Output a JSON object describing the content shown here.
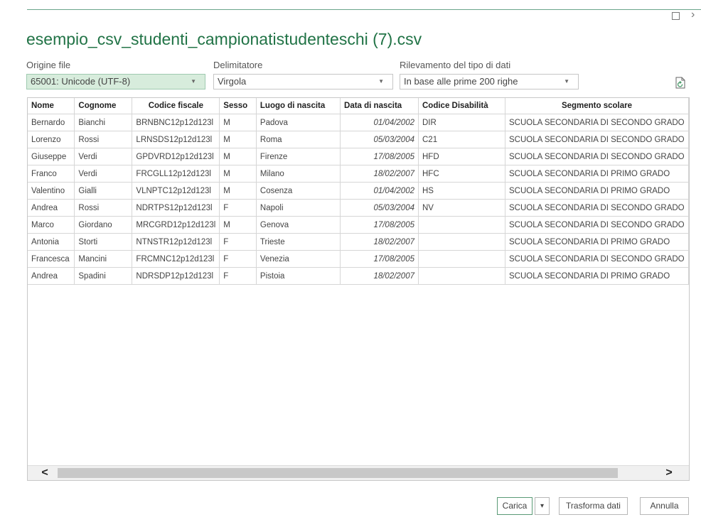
{
  "window": {
    "title": "esempio_csv_studenti_campionatistudenteschi (7).csv",
    "maximize_glyph": "☐",
    "close_glyph": "›"
  },
  "settings": {
    "origin": {
      "label": "Origine file",
      "value": "65001: Unicode (UTF-8)"
    },
    "delimiter": {
      "label": "Delimitatore",
      "value": "Virgola"
    },
    "detection": {
      "label": "Rilevamento del tipo di dati",
      "value": "In base alle prime 200 righe"
    }
  },
  "table": {
    "columns": [
      "Nome",
      "Cognome",
      "Codice fiscale",
      "Sesso",
      "Luogo di nascita",
      "Data di nascita",
      "Codice Disabilità",
      "Segmento scolare"
    ],
    "rows": [
      [
        "Bernardo",
        "Bianchi",
        "BRNBNC12p12d123l",
        "M",
        "Padova",
        "01/04/2002",
        "DIR",
        "SCUOLA SECONDARIA DI SECONDO GRADO"
      ],
      [
        "Lorenzo",
        "Rossi",
        "LRNSDS12p12d123l",
        "M",
        "Roma",
        "05/03/2004",
        "C21",
        "SCUOLA SECONDARIA DI SECONDO GRADO"
      ],
      [
        "Giuseppe",
        "Verdi",
        "GPDVRD12p12d123l",
        "M",
        "Firenze",
        "17/08/2005",
        "HFD",
        "SCUOLA SECONDARIA DI SECONDO GRADO"
      ],
      [
        "Franco",
        "Verdi",
        "FRCGLL12p12d123l",
        "M",
        "Milano",
        "18/02/2007",
        "HFC",
        "SCUOLA SECONDARIA DI PRIMO GRADO"
      ],
      [
        "Valentino",
        "Gialli",
        "VLNPTC12p12d123l",
        "M",
        "Cosenza",
        "01/04/2002",
        "HS",
        "SCUOLA SECONDARIA DI PRIMO GRADO"
      ],
      [
        "Andrea",
        "Rossi",
        "NDRTPS12p12d123l",
        "F",
        "Napoli",
        "05/03/2004",
        "NV",
        "SCUOLA SECONDARIA DI SECONDO GRADO"
      ],
      [
        "Marco",
        "Giordano",
        "MRCGRD12p12d123l",
        "M",
        "Genova",
        "17/08/2005",
        "",
        "SCUOLA SECONDARIA DI SECONDO GRADO"
      ],
      [
        "Antonia",
        "Storti",
        "NTNSTR12p12d123l",
        "F",
        "Trieste",
        "18/02/2007",
        "",
        "SCUOLA SECONDARIA DI PRIMO GRADO"
      ],
      [
        "Francesca",
        "Mancini",
        "FRCMNC12p12d123l",
        "F",
        "Venezia",
        "17/08/2005",
        "",
        "SCUOLA SECONDARIA DI SECONDO GRADO"
      ],
      [
        "Andrea",
        "Spadini",
        "NDRSDP12p12d123l",
        "F",
        "Pistoia",
        "18/02/2007",
        "",
        "SCUOLA SECONDARIA DI PRIMO GRADO"
      ]
    ]
  },
  "scroll": {
    "left_glyph": "<",
    "right_glyph": ">"
  },
  "buttons": {
    "load": "Carica",
    "load_menu_glyph": "▾",
    "transform": "Trasforma dati",
    "cancel": "Annulla"
  },
  "icons": {
    "dropdown": "chevron-down-icon",
    "refresh": "refresh-document-icon"
  },
  "colors": {
    "accent": "#217346",
    "selected_combo_bg": "#d7ecdc"
  }
}
